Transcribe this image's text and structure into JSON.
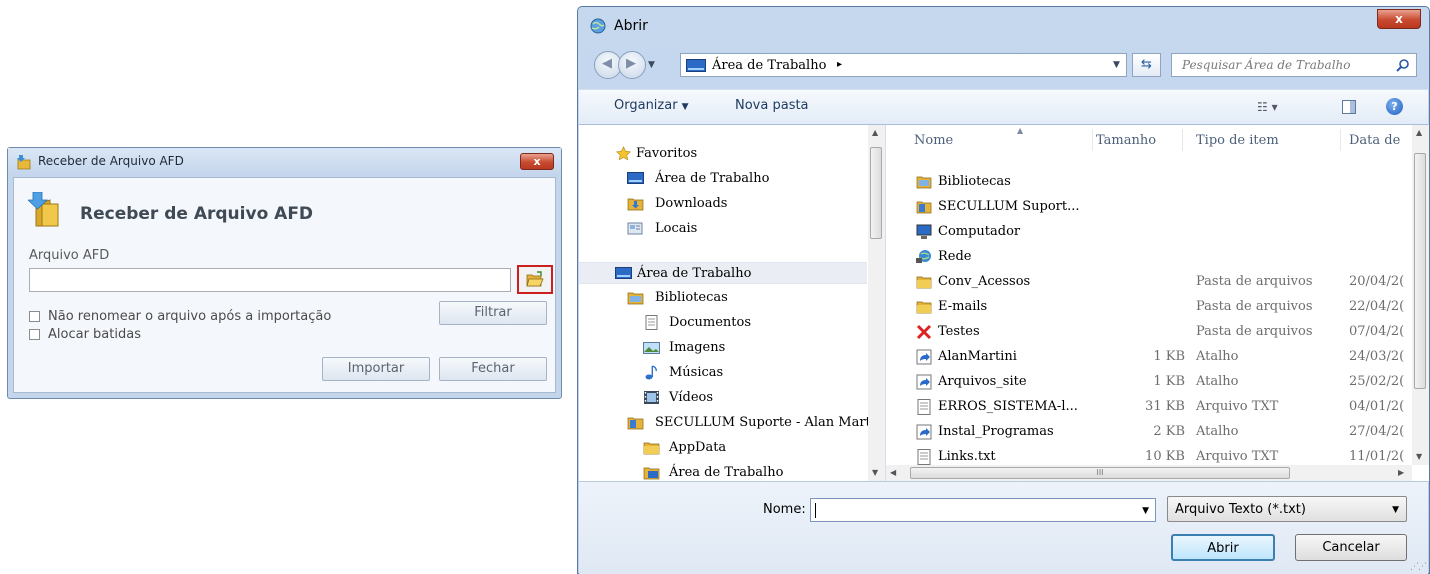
{
  "afd_dialog": {
    "window_title": "Receber de Arquivo AFD",
    "close_glyph": "x",
    "heading": "Receber de Arquivo AFD",
    "field_label": "Arquivo AFD",
    "file_path_value": "",
    "checkbox_no_rename_label": "Não renomear o arquivo após a importação",
    "checkbox_no_rename_checked": false,
    "checkbox_allocate_label": "Alocar batidas",
    "checkbox_allocate_checked": false,
    "filter_button": "Filtrar",
    "import_button": "Importar",
    "close_button": "Fechar",
    "icons": {
      "title": "folder-arrow-icon",
      "heading": "folder-arrow-icon",
      "browse": "open-folder-icon"
    },
    "colors": {
      "highlight": "#cc1f1f",
      "heading_text": "#404a55"
    }
  },
  "open_dialog": {
    "window_title": "Abrir",
    "close_glyph": "x",
    "address": {
      "location": "Área de Trabalho",
      "separator": "▸"
    },
    "search_placeholder": "Pesquisar Área de Trabalho",
    "toolbar": {
      "organize": "Organizar",
      "new_folder": "Nova pasta"
    },
    "nav_pane": [
      {
        "label": "Favoritos",
        "icon": "star-icon"
      },
      {
        "label": "Área de Trabalho",
        "icon": "desktop-icon"
      },
      {
        "label": "Downloads",
        "icon": "downloads-folder-icon"
      },
      {
        "label": "Locais",
        "icon": "recent-places-icon"
      },
      {
        "label": "Área de Trabalho",
        "icon": "desktop-icon"
      },
      {
        "label": "Bibliotecas",
        "icon": "libraries-icon"
      },
      {
        "label": "Documentos",
        "icon": "documents-icon"
      },
      {
        "label": "Imagens",
        "icon": "pictures-icon"
      },
      {
        "label": "Músicas",
        "icon": "music-icon"
      },
      {
        "label": "Vídeos",
        "icon": "videos-icon"
      },
      {
        "label": "SECULLUM Suporte - Alan Mart",
        "icon": "user-folder-icon"
      },
      {
        "label": "AppData",
        "icon": "folder-icon"
      },
      {
        "label": "Área de Trabalho",
        "icon": "desktop-folder-icon"
      }
    ],
    "columns": {
      "name": "Nome",
      "size": "Tamanho",
      "type": "Tipo de item",
      "date": "Data de"
    },
    "files": [
      {
        "name": "Bibliotecas",
        "size": "",
        "type": "",
        "date": "",
        "icon": "libraries-icon"
      },
      {
        "name": "SECULLUM Suport...",
        "size": "",
        "type": "",
        "date": "",
        "icon": "user-folder-icon"
      },
      {
        "name": "Computador",
        "size": "",
        "type": "",
        "date": "",
        "icon": "computer-icon"
      },
      {
        "name": "Rede",
        "size": "",
        "type": "",
        "date": "",
        "icon": "network-icon"
      },
      {
        "name": "Conv_Acessos",
        "size": "",
        "type": "Pasta de arquivos",
        "date": "20/04/2(",
        "icon": "folder-icon"
      },
      {
        "name": "E-mails",
        "size": "",
        "type": "Pasta de arquivos",
        "date": "22/04/2(",
        "icon": "folder-icon"
      },
      {
        "name": "Testes",
        "size": "",
        "type": "Pasta de arquivos",
        "date": "07/04/2(",
        "icon": "red-x-icon"
      },
      {
        "name": "AlanMartini",
        "size": "1 KB",
        "type": "Atalho",
        "date": "24/03/2(",
        "icon": "shortcut-icon"
      },
      {
        "name": "Arquivos_site",
        "size": "1 KB",
        "type": "Atalho",
        "date": "25/02/2(",
        "icon": "shortcut-icon"
      },
      {
        "name": "ERROS_SISTEMA-l...",
        "size": "31 KB",
        "type": "Arquivo TXT",
        "date": "04/01/2(",
        "icon": "text-file-icon"
      },
      {
        "name": "Instal_Programas",
        "size": "2 KB",
        "type": "Atalho",
        "date": "27/04/2(",
        "icon": "shortcut-icon"
      },
      {
        "name": "Links.txt",
        "size": "10 KB",
        "type": "Arquivo TXT",
        "date": "11/01/2(",
        "icon": "text-file-icon"
      }
    ],
    "hscroll_glyph": "III",
    "file_name_label": "Nome:",
    "file_name_value": "",
    "file_type_filter": "Arquivo Texto (*.txt)",
    "open_button": "Abrir",
    "cancel_button": "Cancelar",
    "colors": {
      "frame": "#bcd0ea",
      "accent_button": "#3c7fb1",
      "link_text": "#1e3a5e"
    }
  }
}
